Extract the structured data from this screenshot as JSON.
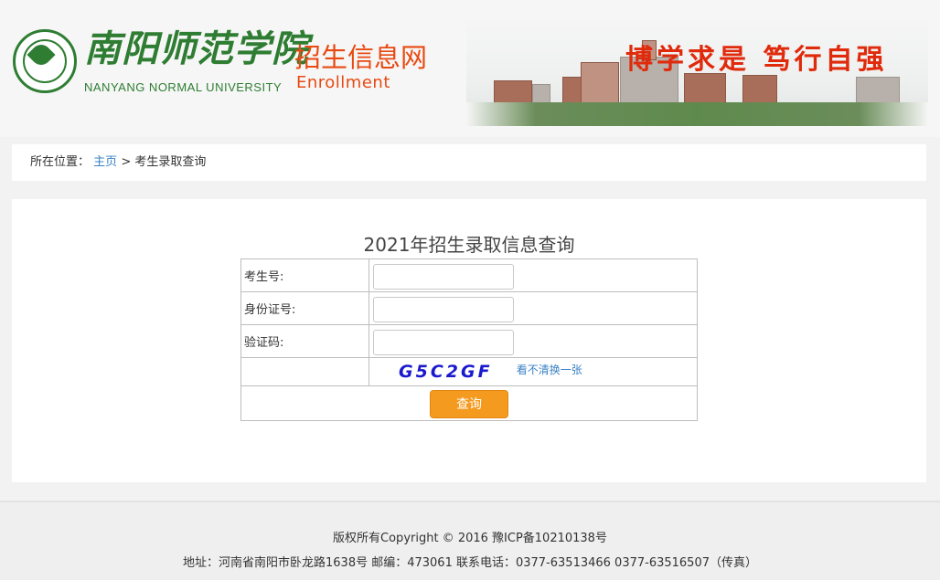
{
  "header": {
    "university_cn": "南阳师范学院",
    "university_en": "NANYANG NORMAL UNIVERSITY",
    "site_cn": "招生信息网",
    "site_en": "Enrollment",
    "motto": "博学求是 笃行自强",
    "brand_color": "#e84a12",
    "logo_color": "#2e7d32"
  },
  "breadcrumb": {
    "label": "所在位置：",
    "home": "主页",
    "separator": ">",
    "current": "考生录取查询"
  },
  "query": {
    "title": "2021年招生录取信息查询",
    "fields": [
      {
        "label": "考生号:",
        "value": ""
      },
      {
        "label": "身份证号:",
        "value": ""
      },
      {
        "label": "验证码:",
        "value": ""
      }
    ],
    "captcha_code": "G5C2GF",
    "refresh_text": "看不清换一张",
    "submit_label": "查询",
    "button_color": "#f39a1f"
  },
  "footer": {
    "copyright": "版权所有Copyright © 2016 豫ICP备10210138号",
    "address": "地址：河南省南阳市卧龙路1638号 邮编：473061 联系电话：0377-63513466 0377-63516507（传真）"
  }
}
